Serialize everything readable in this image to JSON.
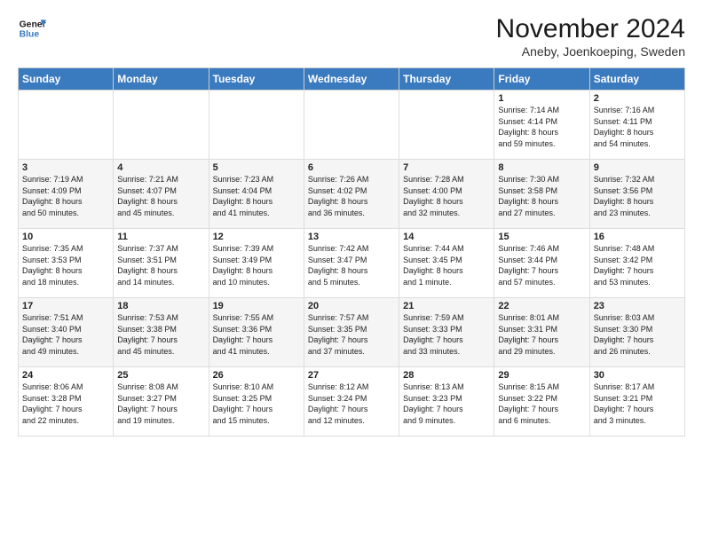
{
  "header": {
    "logo_line1": "General",
    "logo_line2": "Blue",
    "month": "November 2024",
    "location": "Aneby, Joenkoeping, Sweden"
  },
  "weekdays": [
    "Sunday",
    "Monday",
    "Tuesday",
    "Wednesday",
    "Thursday",
    "Friday",
    "Saturday"
  ],
  "weeks": [
    [
      {
        "day": "",
        "info": ""
      },
      {
        "day": "",
        "info": ""
      },
      {
        "day": "",
        "info": ""
      },
      {
        "day": "",
        "info": ""
      },
      {
        "day": "",
        "info": ""
      },
      {
        "day": "1",
        "info": "Sunrise: 7:14 AM\nSunset: 4:14 PM\nDaylight: 8 hours\nand 59 minutes."
      },
      {
        "day": "2",
        "info": "Sunrise: 7:16 AM\nSunset: 4:11 PM\nDaylight: 8 hours\nand 54 minutes."
      }
    ],
    [
      {
        "day": "3",
        "info": "Sunrise: 7:19 AM\nSunset: 4:09 PM\nDaylight: 8 hours\nand 50 minutes."
      },
      {
        "day": "4",
        "info": "Sunrise: 7:21 AM\nSunset: 4:07 PM\nDaylight: 8 hours\nand 45 minutes."
      },
      {
        "day": "5",
        "info": "Sunrise: 7:23 AM\nSunset: 4:04 PM\nDaylight: 8 hours\nand 41 minutes."
      },
      {
        "day": "6",
        "info": "Sunrise: 7:26 AM\nSunset: 4:02 PM\nDaylight: 8 hours\nand 36 minutes."
      },
      {
        "day": "7",
        "info": "Sunrise: 7:28 AM\nSunset: 4:00 PM\nDaylight: 8 hours\nand 32 minutes."
      },
      {
        "day": "8",
        "info": "Sunrise: 7:30 AM\nSunset: 3:58 PM\nDaylight: 8 hours\nand 27 minutes."
      },
      {
        "day": "9",
        "info": "Sunrise: 7:32 AM\nSunset: 3:56 PM\nDaylight: 8 hours\nand 23 minutes."
      }
    ],
    [
      {
        "day": "10",
        "info": "Sunrise: 7:35 AM\nSunset: 3:53 PM\nDaylight: 8 hours\nand 18 minutes."
      },
      {
        "day": "11",
        "info": "Sunrise: 7:37 AM\nSunset: 3:51 PM\nDaylight: 8 hours\nand 14 minutes."
      },
      {
        "day": "12",
        "info": "Sunrise: 7:39 AM\nSunset: 3:49 PM\nDaylight: 8 hours\nand 10 minutes."
      },
      {
        "day": "13",
        "info": "Sunrise: 7:42 AM\nSunset: 3:47 PM\nDaylight: 8 hours\nand 5 minutes."
      },
      {
        "day": "14",
        "info": "Sunrise: 7:44 AM\nSunset: 3:45 PM\nDaylight: 8 hours\nand 1 minute."
      },
      {
        "day": "15",
        "info": "Sunrise: 7:46 AM\nSunset: 3:44 PM\nDaylight: 7 hours\nand 57 minutes."
      },
      {
        "day": "16",
        "info": "Sunrise: 7:48 AM\nSunset: 3:42 PM\nDaylight: 7 hours\nand 53 minutes."
      }
    ],
    [
      {
        "day": "17",
        "info": "Sunrise: 7:51 AM\nSunset: 3:40 PM\nDaylight: 7 hours\nand 49 minutes."
      },
      {
        "day": "18",
        "info": "Sunrise: 7:53 AM\nSunset: 3:38 PM\nDaylight: 7 hours\nand 45 minutes."
      },
      {
        "day": "19",
        "info": "Sunrise: 7:55 AM\nSunset: 3:36 PM\nDaylight: 7 hours\nand 41 minutes."
      },
      {
        "day": "20",
        "info": "Sunrise: 7:57 AM\nSunset: 3:35 PM\nDaylight: 7 hours\nand 37 minutes."
      },
      {
        "day": "21",
        "info": "Sunrise: 7:59 AM\nSunset: 3:33 PM\nDaylight: 7 hours\nand 33 minutes."
      },
      {
        "day": "22",
        "info": "Sunrise: 8:01 AM\nSunset: 3:31 PM\nDaylight: 7 hours\nand 29 minutes."
      },
      {
        "day": "23",
        "info": "Sunrise: 8:03 AM\nSunset: 3:30 PM\nDaylight: 7 hours\nand 26 minutes."
      }
    ],
    [
      {
        "day": "24",
        "info": "Sunrise: 8:06 AM\nSunset: 3:28 PM\nDaylight: 7 hours\nand 22 minutes."
      },
      {
        "day": "25",
        "info": "Sunrise: 8:08 AM\nSunset: 3:27 PM\nDaylight: 7 hours\nand 19 minutes."
      },
      {
        "day": "26",
        "info": "Sunrise: 8:10 AM\nSunset: 3:25 PM\nDaylight: 7 hours\nand 15 minutes."
      },
      {
        "day": "27",
        "info": "Sunrise: 8:12 AM\nSunset: 3:24 PM\nDaylight: 7 hours\nand 12 minutes."
      },
      {
        "day": "28",
        "info": "Sunrise: 8:13 AM\nSunset: 3:23 PM\nDaylight: 7 hours\nand 9 minutes."
      },
      {
        "day": "29",
        "info": "Sunrise: 8:15 AM\nSunset: 3:22 PM\nDaylight: 7 hours\nand 6 minutes."
      },
      {
        "day": "30",
        "info": "Sunrise: 8:17 AM\nSunset: 3:21 PM\nDaylight: 7 hours\nand 3 minutes."
      }
    ]
  ]
}
